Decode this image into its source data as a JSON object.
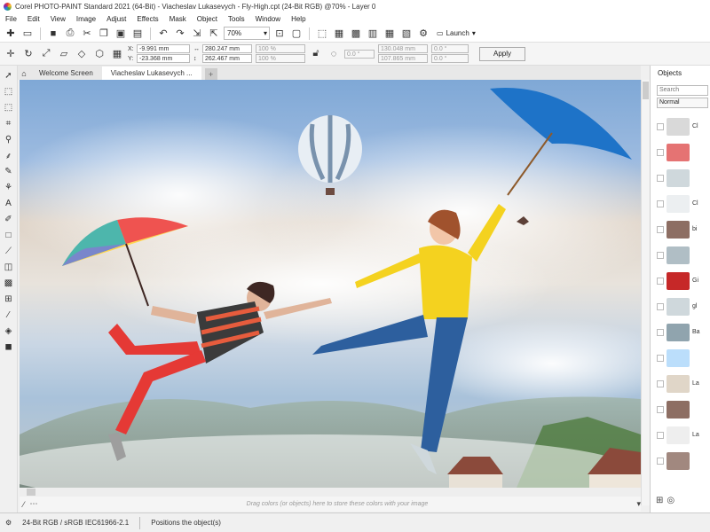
{
  "window": {
    "title": "Corel PHOTO-PAINT Standard 2021 (64-Bit) - Viacheslav Lukasevych - Fly-High.cpt (24-Bit RGB) @70% - Layer 0"
  },
  "menu": [
    "File",
    "Edit",
    "View",
    "Image",
    "Adjust",
    "Effects",
    "Mask",
    "Object",
    "Tools",
    "Window",
    "Help"
  ],
  "toolbar": {
    "zoom": "70%",
    "launch_label": "Launch"
  },
  "property_bar": {
    "x_label": "X:",
    "x_value": "-9.991 mm",
    "y_label": "Y:",
    "y_value": "-23.368 mm",
    "width_value": "280.247 mm",
    "height_value": "262.467 mm",
    "scale_w": "100 %",
    "scale_h": "100 %",
    "rotation": "0.0 °",
    "center_x": "130.048 mm",
    "center_y": "107.865 mm",
    "skew_h": "0.0 °",
    "skew_v": "0.0 °",
    "apply_label": "Apply"
  },
  "tabs": [
    {
      "label": "Welcome Screen",
      "active": false
    },
    {
      "label": "Viacheslav Lukasevych ...",
      "active": true
    }
  ],
  "canvas": {
    "colorwell_hint": "Drag colors (or objects) here to store these colors with your image"
  },
  "docker": {
    "title": "Objects",
    "search_placeholder": "Search",
    "blend_mode": "Normal",
    "layers": [
      {
        "name": "Cl",
        "thumb_color": "#d9d9d9"
      },
      {
        "name": "",
        "thumb_color": "#e57373"
      },
      {
        "name": "",
        "thumb_color": "#cfd8dc"
      },
      {
        "name": "Cl",
        "thumb_color": "#eceff1"
      },
      {
        "name": "bi",
        "thumb_color": "#8d6e63"
      },
      {
        "name": "",
        "thumb_color": "#b0bec5"
      },
      {
        "name": "Gi",
        "thumb_color": "#c62828"
      },
      {
        "name": "gl",
        "thumb_color": "#cfd8dc"
      },
      {
        "name": "Ba",
        "thumb_color": "#90a4ae"
      },
      {
        "name": "",
        "thumb_color": "#bbdefb"
      },
      {
        "name": "La",
        "thumb_color": "#e0d6c8"
      },
      {
        "name": "",
        "thumb_color": "#8d6e63"
      },
      {
        "name": "La",
        "thumb_color": "#eeeeee"
      },
      {
        "name": "",
        "thumb_color": "#a1887f"
      }
    ]
  },
  "status": {
    "color_mode": "24-Bit RGB / sRGB IEC61966-2.1",
    "hint": "Positions the object(s)"
  }
}
